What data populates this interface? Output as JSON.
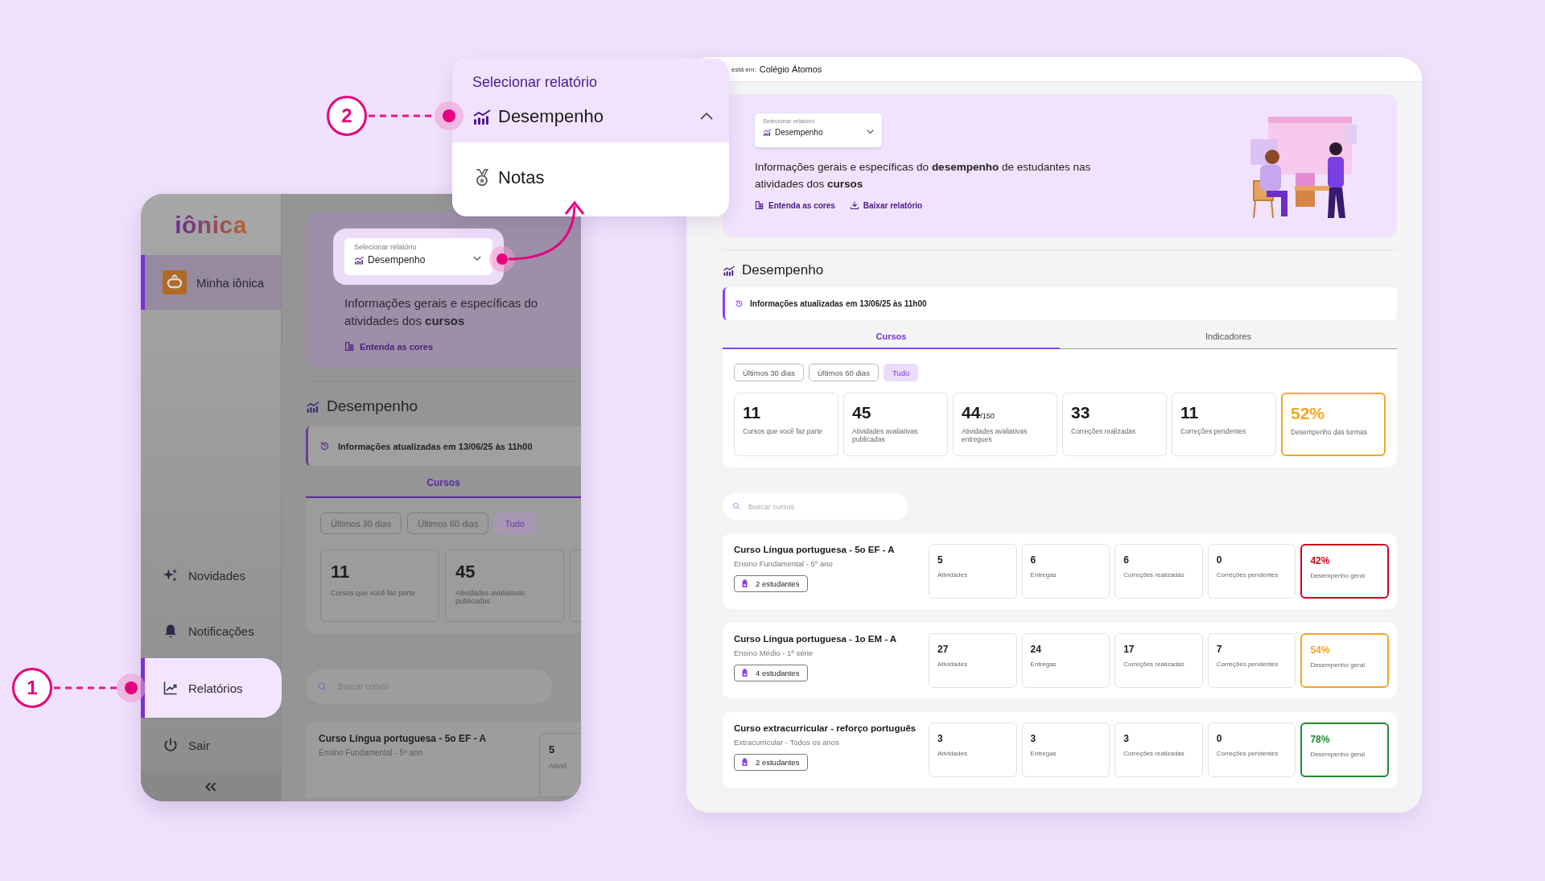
{
  "callouts": [
    {
      "number": "1"
    },
    {
      "number": "2"
    }
  ],
  "report_menu": {
    "label": "Selecionar relatório",
    "expanded": true,
    "options": [
      {
        "label": "Desempenho",
        "kind": "performance",
        "selected": true
      },
      {
        "label": "Notas",
        "kind": "grades",
        "selected": false
      }
    ]
  },
  "left_screen": {
    "logo": "iônica",
    "sidebar": {
      "top": [
        {
          "label": "Minha iônica",
          "kind": "home",
          "selected": true,
          "highlighted": false
        }
      ],
      "bottom": [
        {
          "label": "Novidades",
          "kind": "news",
          "selected": false,
          "highlighted": false
        },
        {
          "label": "Notificações",
          "kind": "bell",
          "selected": false,
          "highlighted": false
        },
        {
          "label": "Relatórios",
          "kind": "reports",
          "selected": true,
          "highlighted": true
        },
        {
          "label": "Sair",
          "kind": "logout",
          "selected": false,
          "highlighted": false
        }
      ]
    },
    "report_select": {
      "label": "Selecionar relatório",
      "value": "Desempenho"
    },
    "description_lines": [
      "Informações gerais e específicas do",
      "atividades dos **cursos**"
    ],
    "links": [
      {
        "label": "Entenda as cores",
        "kind": "colors"
      }
    ],
    "section_title": "Desempenho",
    "update_info": "Informações atualizadas em 13/06/25 às 11h00",
    "tabs": [
      {
        "label": "Cursos",
        "selected": true
      }
    ],
    "ranges": [
      {
        "label": "Últimos 30 dias",
        "selected": false
      },
      {
        "label": "Últimos 60 dias",
        "selected": false
      },
      {
        "label": "Tudo",
        "selected": true
      }
    ],
    "stats": [
      {
        "value": "11",
        "label": "Cursos que você faz parte"
      },
      {
        "value": "45",
        "label": "Atividades avaliativas publicadas"
      }
    ],
    "search_placeholder": "Buscar cursos",
    "course": {
      "title": "Curso Língua portuguesa - 5o EF - A",
      "subtitle": "Ensino Fundamental - 5º ano",
      "metric": {
        "value": "5",
        "label": "Ativid"
      }
    }
  },
  "right_screen": {
    "breadcrumb": {
      "prefix": "está em:",
      "school": "Colégio Átomos"
    },
    "report_select": {
      "label": "Selecionar relatório",
      "value": "Desempenho"
    },
    "description": "Informações gerais e específicas do **desempenho** de estudantes nas atividades dos **cursos**",
    "links": [
      {
        "label": "Entenda as cores",
        "kind": "colors"
      },
      {
        "label": "Baixar relatório",
        "kind": "download"
      }
    ],
    "section_title": "Desempenho",
    "update_info": "Informações atualizadas em 13/06/25 às 11h00",
    "tabs": [
      {
        "label": "Cursos",
        "selected": true
      },
      {
        "label": "Indicadores",
        "selected": false
      }
    ],
    "ranges": [
      {
        "label": "Últimos 30 dias",
        "selected": false
      },
      {
        "label": "Últimos 60 dias",
        "selected": false
      },
      {
        "label": "Tudo",
        "selected": true
      }
    ],
    "stats": [
      {
        "kind": "count",
        "value": "11",
        "label": "Cursos que você faz parte"
      },
      {
        "kind": "count",
        "value": "45",
        "label": "Atividades avaliativas publicadas"
      },
      {
        "kind": "count",
        "value": "44",
        "total": "/150",
        "label": "Atividades avaliativas entregues"
      },
      {
        "kind": "count",
        "value": "33",
        "label": "Correções realizadas"
      },
      {
        "kind": "count",
        "value": "11",
        "label": "Correções pendentes"
      },
      {
        "kind": "performance",
        "value": "52%",
        "label": "Desempenho das turmas",
        "color": "#f5a623"
      }
    ],
    "search_placeholder": "Buscar cursos",
    "courses": [
      {
        "title": "Curso Língua portuguesa - 5o EF - A",
        "subtitle": "Ensino Fundamental - 5º ano",
        "students": "2 estudantes",
        "metrics": [
          {
            "value": "5",
            "label": "Atividades"
          },
          {
            "value": "6",
            "label": "Entregas"
          },
          {
            "value": "6",
            "label": "Correções realizadas"
          },
          {
            "value": "0",
            "label": "Correções pendentes"
          }
        ],
        "performance": {
          "value": "42%",
          "label": "Desempenho geral",
          "color": "#d0021b"
        }
      },
      {
        "title": "Curso Língua portuguesa - 1o EM - A",
        "subtitle": "Ensino Médio - 1ª série",
        "students": "4 estudantes",
        "metrics": [
          {
            "value": "27",
            "label": "Atividades"
          },
          {
            "value": "24",
            "label": "Entregas"
          },
          {
            "value": "17",
            "label": "Correções realizadas"
          },
          {
            "value": "7",
            "label": "Correções pendentes"
          }
        ],
        "performance": {
          "value": "54%",
          "label": "Desempenho geral",
          "color": "#f5a623"
        }
      },
      {
        "title": "Curso extracurricular - reforço português",
        "subtitle": "Extracurricular - Todos os anos",
        "students": "2 estudantes",
        "metrics": [
          {
            "value": "3",
            "label": "Atividades"
          },
          {
            "value": "3",
            "label": "Entregas"
          },
          {
            "value": "3",
            "label": "Correções realizadas"
          },
          {
            "value": "0",
            "label": "Correções pendentes"
          }
        ],
        "performance": {
          "value": "78%",
          "label": "Desempenho geral",
          "color": "#1e8a2e"
        }
      }
    ]
  }
}
